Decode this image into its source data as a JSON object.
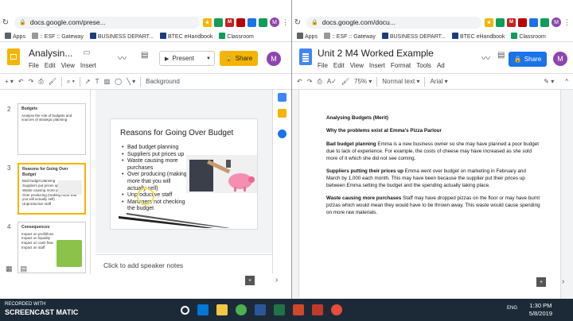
{
  "left": {
    "url": "docs.google.com/prese...",
    "bookmarks": [
      "Apps",
      ":: ESF :: Gateway",
      "BUSINESS DEPART...",
      "BTEC eHandbook",
      "Classroom"
    ],
    "doc_title": "Analysin...",
    "menu": [
      "File",
      "Edit",
      "View",
      "Insert"
    ],
    "present_label": "Present",
    "share_label": "Share",
    "avatar_letter": "M",
    "toolbar_background": "Background",
    "slides": [
      {
        "num": "2",
        "title": "Budgets",
        "lines": [
          "Analyse the role of budgets and sources of strategic planning"
        ]
      },
      {
        "num": "3",
        "title": "Reasons for Going Over Budget",
        "lines": [
          "Bad budget planning",
          "Suppliers put prices up",
          "Waste causing more purchases",
          "Over producing (making more that you will actually sell)",
          "Unproductive staff",
          "Managers not checking the budget"
        ]
      },
      {
        "num": "4",
        "title": "Consequences",
        "lines": [
          "Impact on profit/loss",
          "Impact on liquidity",
          "Impact on cash flow",
          "Impact on staff",
          "Impact on budget"
        ]
      }
    ],
    "current_slide": {
      "title": "Reasons for Going Over Budget",
      "bullets": [
        "Bad budget planning",
        "Suppliers put prices up",
        "Waste causing more purchases",
        "Over producing (making more that you will actually sell)",
        "Unproductive staff",
        "Managers not checking the budget"
      ]
    },
    "speaker_notes": "Click to add speaker notes"
  },
  "right": {
    "url": "docs.google.com/docu...",
    "bookmarks": [
      "Apps",
      ":: ESF :: Gateway",
      "BUSINESS DEPART...",
      "BTEC eHandbook",
      "Classroom"
    ],
    "doc_title": "Unit 2 M4 Worked Example",
    "menu": [
      "File",
      "Edit",
      "View",
      "Insert",
      "Format",
      "Tools",
      "Ad"
    ],
    "share_label": "Share",
    "avatar_letter": "M",
    "zoom": "75%",
    "style": "Normal text",
    "font": "Arial",
    "doc": {
      "heading": "Analysing Budgets (Merit)",
      "subheading": "Why the problems exist at Emma's Pizza Parlour",
      "p1_bold": "Bad budget planning",
      "p1_text": " Emma is a new business owner so she may have planned a poor budget due to lack of experience. For example, the costs of cheese may have increased as she sold more of it which she did not see coming.",
      "p2_bold": "Suppliers putting their prices up",
      "p2_text": " Emma went over budget on marketing in February and March by 1,000 each month. This may have been because the supplier put their prices up between Emma setting the budget and the spending actually taking place.",
      "p3_bold": "Waste causing more purchases",
      "p3_text": " Staff may have dropped pizzas on the floor or may have burnt pizzas which would mean they would have to be thrown away. This waste would cause spending on more raw materials."
    }
  },
  "taskbar": {
    "watermark_top": "RECORDED WITH",
    "watermark_brand": "SCREENCAST MATIC",
    "lang": "ENG",
    "time": "1:30 PM",
    "date": "5/8/2019"
  },
  "colors": {
    "share_blue": "#1a73e8",
    "slides_yellow": "#f4b400",
    "docs_blue": "#4285f4",
    "taskbar": "#1c2a38"
  }
}
